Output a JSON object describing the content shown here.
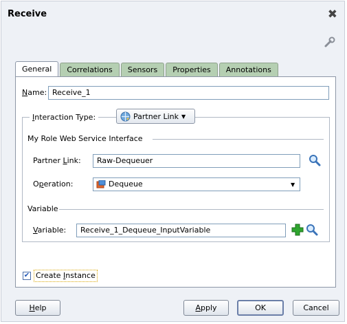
{
  "dialog": {
    "title": "Receive",
    "tabs": [
      {
        "label": "General",
        "active": true
      },
      {
        "label": "Correlations",
        "active": false
      },
      {
        "label": "Sensors",
        "active": false
      },
      {
        "label": "Properties",
        "active": false
      },
      {
        "label": "Annotations",
        "active": false
      }
    ],
    "name": {
      "label_prefix": "",
      "label_accel": "N",
      "label_rest": "ame:",
      "value": "Receive_1"
    },
    "interaction": {
      "label_accel": "I",
      "label_rest": "nteraction Type:",
      "value": "Partner Link"
    },
    "role": {
      "title": "My Role Web Service Interface",
      "partner_link": {
        "label_prefix": "Partner ",
        "label_accel": "L",
        "label_rest": "ink:",
        "value": "Raw-Dequeuer"
      },
      "operation": {
        "label_prefix": "O",
        "label_accel": "p",
        "label_rest": "eration:",
        "value": "Dequeue"
      }
    },
    "variable": {
      "title": "Variable",
      "field": {
        "label_prefix": "",
        "label_accel": "V",
        "label_rest": "ariable:",
        "value": "Receive_1_Dequeue_InputVariable"
      }
    },
    "create_instance": {
      "checked": true,
      "label_prefix": "Create ",
      "label_accel": "I",
      "label_rest": "nstance"
    },
    "buttons": {
      "help": {
        "accel": "H",
        "rest": "elp"
      },
      "apply": {
        "accel": "A",
        "rest": "pply"
      },
      "ok": {
        "label": "OK"
      },
      "cancel": {
        "label": "Cancel"
      }
    },
    "colors": {
      "tab_inactive": "#b5cfb2",
      "background": "#eef1f6",
      "accent_green": "#2fa52f"
    }
  }
}
